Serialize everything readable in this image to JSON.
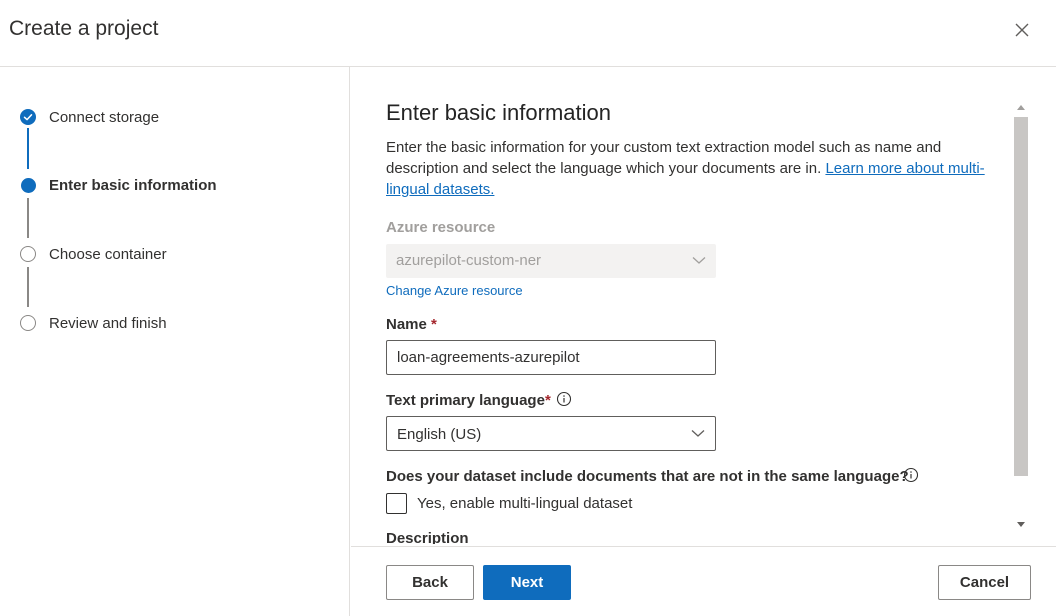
{
  "dialog": {
    "title": "Create a project"
  },
  "steps": [
    {
      "label": "Connect storage",
      "state": "completed"
    },
    {
      "label": "Enter basic information",
      "state": "current"
    },
    {
      "label": "Choose container",
      "state": "pending"
    },
    {
      "label": "Review and finish",
      "state": "pending"
    }
  ],
  "form": {
    "title": "Enter basic information",
    "description": "Enter the basic information for your custom text extraction model such as name and description and select the language which your documents are in.",
    "learn_more_link": "Learn more about multi-lingual datasets.",
    "azure_resource": {
      "label": "Azure resource",
      "value": "azurepilot-custom-ner",
      "change_link": "Change Azure resource"
    },
    "name": {
      "label": "Name",
      "required_mark": "*",
      "value": "loan-agreements-azurepilot"
    },
    "language": {
      "label": "Text primary language",
      "required_mark": "*",
      "value": "English (US)"
    },
    "multilingual": {
      "question": "Does your dataset include documents that are not in the same language?",
      "checkbox_label": "Yes, enable multi-lingual dataset",
      "checked": false
    },
    "description_label": "Description"
  },
  "footer": {
    "back_label": "Back",
    "next_label": "Next",
    "cancel_label": "Cancel"
  },
  "colors": {
    "accent": "#0f6cbd",
    "required": "#a4262c"
  },
  "icons": {
    "close": "close-icon",
    "check": "checkmark-icon",
    "chevron": "chevron-down-icon",
    "info": "info-icon"
  }
}
